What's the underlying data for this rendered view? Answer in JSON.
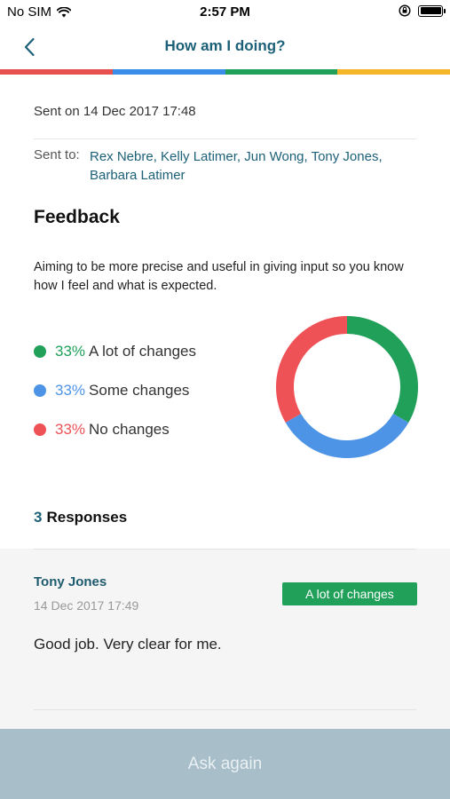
{
  "status_bar": {
    "carrier": "No SIM",
    "time": "2:57 PM"
  },
  "nav": {
    "title": "How am I doing?"
  },
  "stripe_colors": [
    "#e85050",
    "#3b8ee8",
    "#21a05a",
    "#f5b528"
  ],
  "sent": {
    "on": "Sent on 14 Dec 2017 17:48",
    "to_label": "Sent to:",
    "to_names": "Rex Nebre, Kelly Latimer, Jun Wong, Tony Jones, Barbara Latimer"
  },
  "feedback": {
    "title": "Feedback",
    "description": "Aiming to be more precise and useful in giving input so you know how I feel and what is expected."
  },
  "chart_data": {
    "type": "pie",
    "categories": [
      "A lot of changes",
      "Some changes",
      "No changes"
    ],
    "values": [
      33,
      33,
      33
    ],
    "value_labels": [
      "33%",
      "33%",
      "33%"
    ],
    "colors": [
      "#21a05a",
      "#4d94e6",
      "#ee5257"
    ]
  },
  "responses": {
    "count": "3",
    "label": "Responses",
    "items": [
      {
        "name": "Tony Jones",
        "date": "14 Dec 2017 17:49",
        "badge": "A lot of changes",
        "comment": "Good job. Very clear for me."
      }
    ]
  },
  "footer": {
    "button": "Ask again"
  }
}
